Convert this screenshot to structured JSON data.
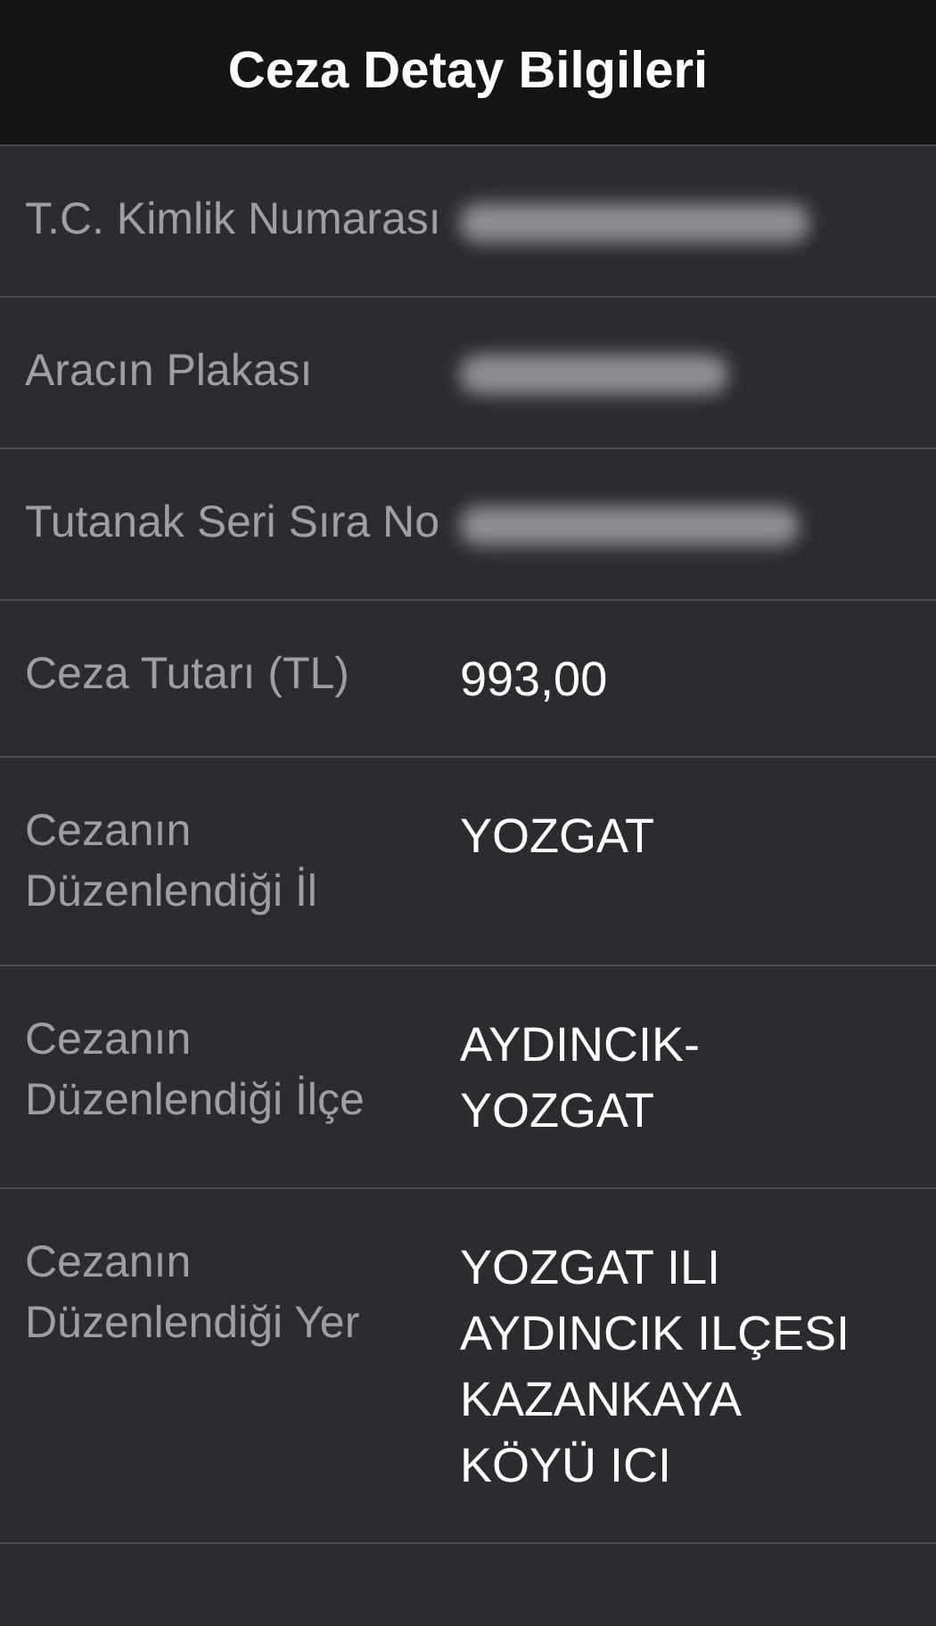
{
  "header": {
    "title": "Ceza Detay Bilgileri"
  },
  "rows": [
    {
      "label": "T.C. Kimlik Numarası",
      "kind": "blurred"
    },
    {
      "label": "Aracın Plakası",
      "kind": "blurred"
    },
    {
      "label": "Tutanak Seri Sıra No",
      "kind": "blurred"
    },
    {
      "label": "Ceza Tutarı (TL)",
      "kind": "text",
      "value": "993,00"
    },
    {
      "label": "Cezanın Düzenlendiği İl",
      "kind": "text",
      "value": "YOZGAT"
    },
    {
      "label": "Cezanın Düzenlendiği İlçe",
      "kind": "text",
      "value": "AYDINCIK-YOZGAT"
    },
    {
      "label": "Cezanın Düzenlendiği Yer",
      "kind": "text",
      "value": "YOZGAT ILI AYDINCIK ILÇESI KAZANKAYA KÖYÜ ICI"
    }
  ]
}
